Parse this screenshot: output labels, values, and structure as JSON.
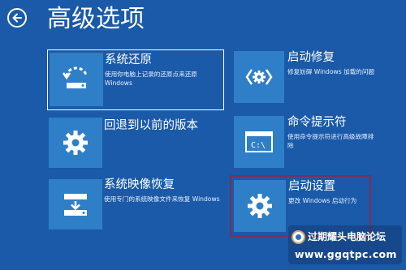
{
  "header": {
    "title": "高级选项",
    "back_icon": "back-arrow-icon"
  },
  "options": [
    {
      "id": "system-restore",
      "name": "系统还原",
      "desc": "使用你电脑上记录的还原点来还原 Windows",
      "icon": "restore-icon",
      "selected": true
    },
    {
      "id": "startup-repair",
      "name": "启动修复",
      "desc": "修复妨碍 Windows 加载的问题",
      "icon": "repair-icon"
    },
    {
      "id": "go-back",
      "name": "回退到以前的版本",
      "desc": "",
      "icon": "gear-icon"
    },
    {
      "id": "command-prompt",
      "name": "命令提示符",
      "desc": "使用命令提示符进行高级故障排除",
      "icon": "command-prompt-icon"
    },
    {
      "id": "system-image",
      "name": "系统映像恢复",
      "desc": "使用专门的系统映像文件来恢复 Windows",
      "icon": "image-recovery-icon"
    },
    {
      "id": "startup-settings",
      "name": "启动设置",
      "desc": "更改 Windows 启动行为",
      "icon": "gear-icon",
      "highlighted": true
    }
  ],
  "watermark": {
    "text": "过期耀头电脑论坛",
    "url": "www.ggqtpc.com"
  },
  "colors": {
    "background": "#1a5aa8",
    "tile": "#2f7fc8",
    "highlight_border": "#8a2850",
    "text": "#ffffff"
  }
}
